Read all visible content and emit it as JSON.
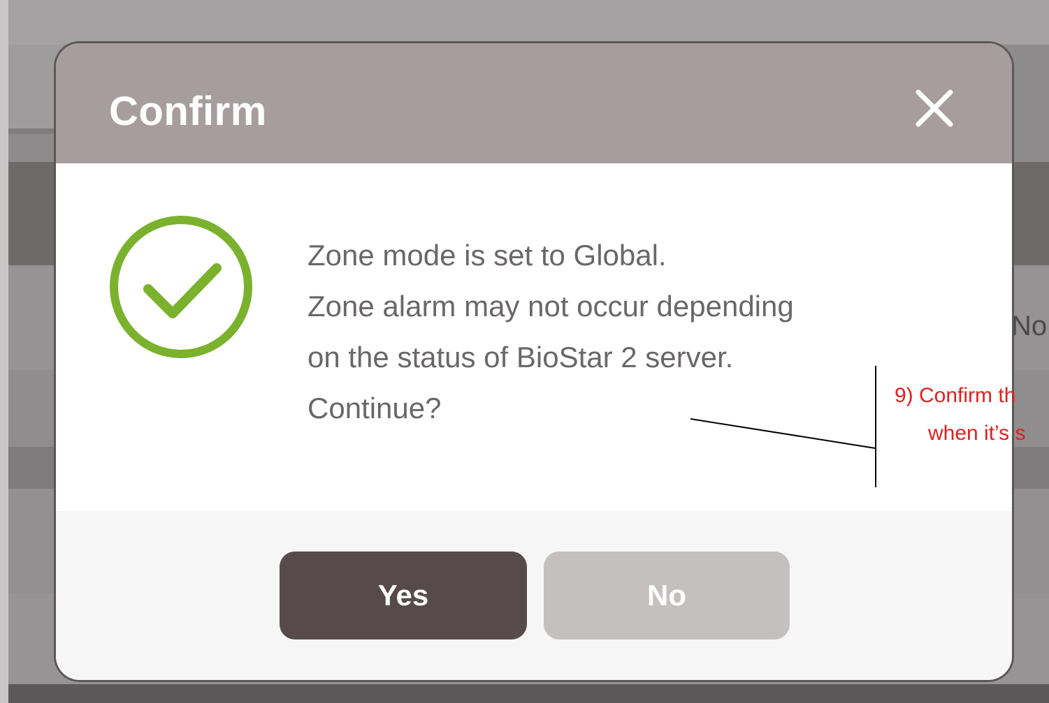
{
  "background": {
    "partial_label": "No"
  },
  "dialog": {
    "title": "Confirm",
    "close_icon": "close-icon",
    "status_icon": "check-circle-icon",
    "status_color": "#7ab22e",
    "message_lines": [
      "Zone mode is set to Global.",
      "Zone alarm may not occur depending",
      "on the status of BioStar 2 server.",
      "Continue?"
    ],
    "yes_label": "Yes",
    "no_label": "No",
    "header_color": "#a79d9f",
    "yes_color": "#574a4d",
    "no_color": "#c5c0c0"
  },
  "annotation": {
    "lines": [
      "9) Confirm th",
      "when it’s s"
    ],
    "color": "#e02020"
  }
}
